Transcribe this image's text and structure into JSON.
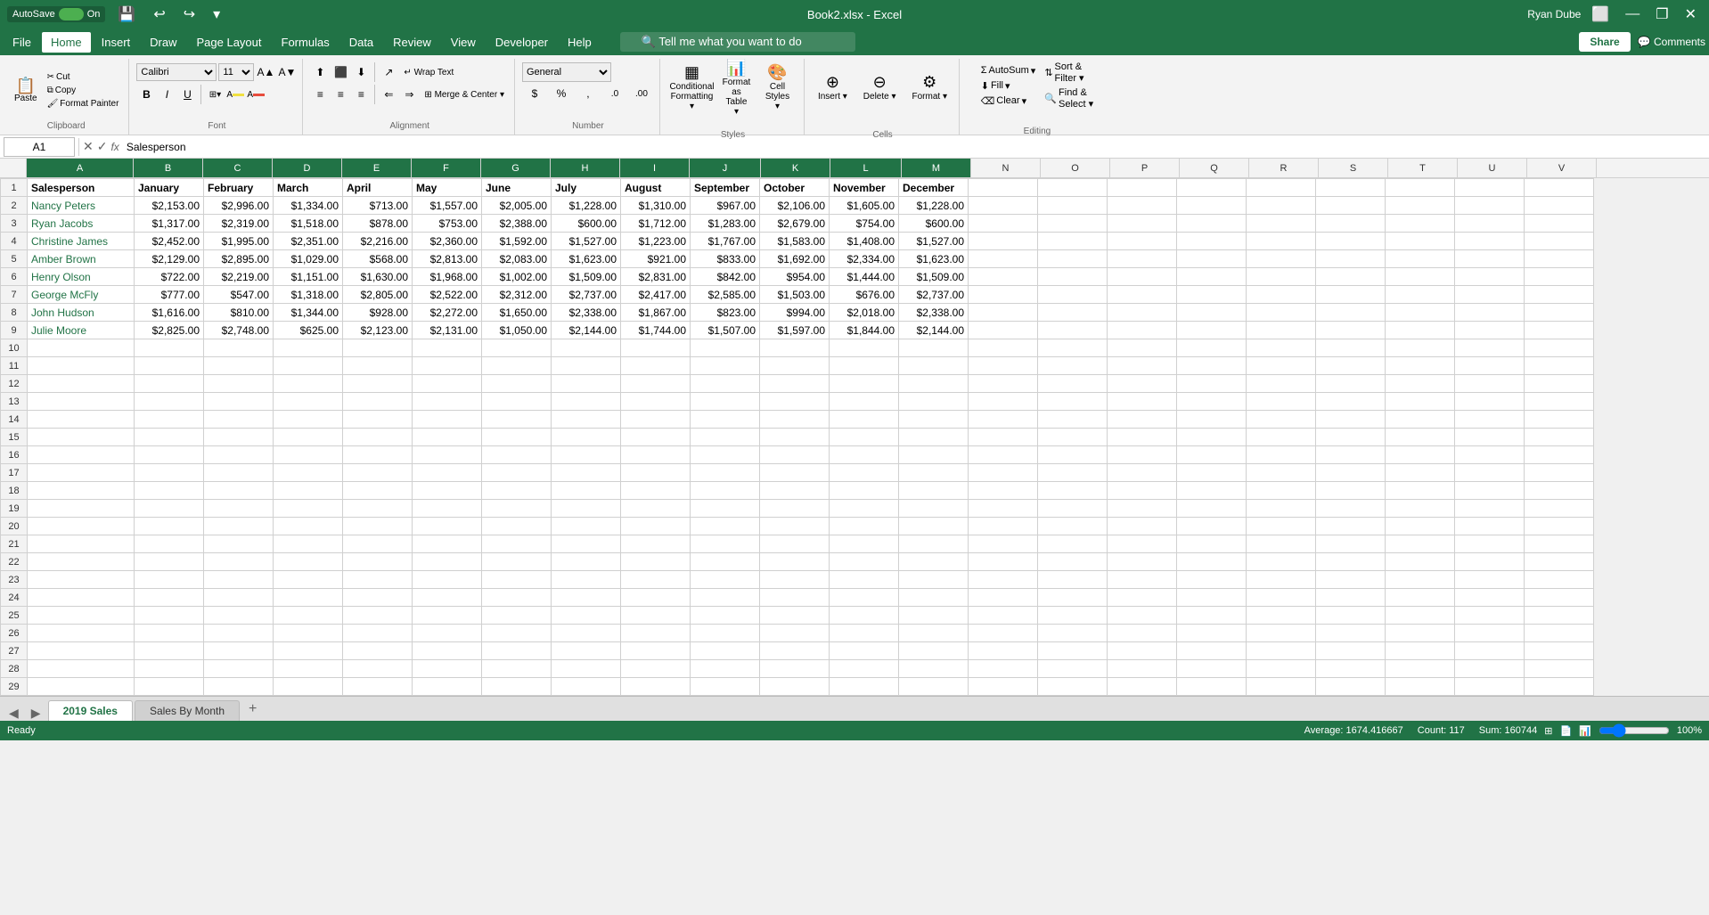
{
  "titleBar": {
    "autosave": "AutoSave",
    "autosaveState": "On",
    "title": "Book2.xlsx - Excel",
    "user": "Ryan Dube"
  },
  "menuBar": {
    "items": [
      "File",
      "Home",
      "Insert",
      "Draw",
      "Page Layout",
      "Formulas",
      "Data",
      "Review",
      "View",
      "Developer",
      "Help"
    ],
    "active": "Home",
    "searchPlaceholder": "Tell me what you want to do",
    "share": "Share",
    "comments": "Comments"
  },
  "ribbon": {
    "clipboard": {
      "label": "Clipboard",
      "paste": "Paste",
      "cut": "Cut",
      "copy": "Copy",
      "formatPainter": "Format Painter"
    },
    "font": {
      "label": "Font",
      "family": "Calibri",
      "size": "11",
      "bold": "B",
      "italic": "I",
      "underline": "U"
    },
    "alignment": {
      "label": "Alignment",
      "wrapText": "Wrap Text",
      "mergeCenter": "Merge & Center"
    },
    "number": {
      "label": "Number",
      "format": "General"
    },
    "styles": {
      "label": "Styles",
      "conditionalFormatting": "Conditional Formatting",
      "formatAsTable": "Format as Table",
      "cellStyles": "Cell Styles"
    },
    "cells": {
      "label": "Cells",
      "insert": "Insert",
      "delete": "Delete",
      "format": "Format"
    },
    "editing": {
      "label": "Editing",
      "autoSum": "AutoSum",
      "fill": "Fill",
      "clear": "Clear",
      "sortFilter": "Sort & Filter",
      "findSelect": "Find & Select"
    }
  },
  "formulaBar": {
    "cellRef": "A1",
    "formula": "Salesperson"
  },
  "columns": [
    "A",
    "B",
    "C",
    "D",
    "E",
    "F",
    "G",
    "H",
    "I",
    "J",
    "K",
    "L",
    "M",
    "N",
    "O",
    "P",
    "Q",
    "R",
    "S",
    "T",
    "U",
    "V"
  ],
  "headers": [
    "Salesperson",
    "January",
    "February",
    "March",
    "April",
    "May",
    "June",
    "July",
    "August",
    "September",
    "October",
    "November",
    "December"
  ],
  "rows": [
    {
      "num": 1,
      "isHeader": true,
      "cells": [
        "Salesperson",
        "January",
        "February",
        "March",
        "April",
        "May",
        "June",
        "July",
        "August",
        "September",
        "October",
        "November",
        "December"
      ]
    },
    {
      "num": 2,
      "cells": [
        "Nancy Peters",
        "$2,153.00",
        "$2,996.00",
        "$1,334.00",
        "$713.00",
        "$1,557.00",
        "$2,005.00",
        "$1,228.00",
        "$1,310.00",
        "$967.00",
        "$2,106.00",
        "$1,605.00",
        "$1,228.00"
      ]
    },
    {
      "num": 3,
      "cells": [
        "Ryan Jacobs",
        "$1,317.00",
        "$2,319.00",
        "$1,518.00",
        "$878.00",
        "$753.00",
        "$2,388.00",
        "$600.00",
        "$1,712.00",
        "$1,283.00",
        "$2,679.00",
        "$754.00",
        "$600.00"
      ]
    },
    {
      "num": 4,
      "cells": [
        "Christine James",
        "$2,452.00",
        "$1,995.00",
        "$2,351.00",
        "$2,216.00",
        "$2,360.00",
        "$1,592.00",
        "$1,527.00",
        "$1,223.00",
        "$1,767.00",
        "$1,583.00",
        "$1,408.00",
        "$1,527.00"
      ]
    },
    {
      "num": 5,
      "cells": [
        "Amber Brown",
        "$2,129.00",
        "$2,895.00",
        "$1,029.00",
        "$568.00",
        "$2,813.00",
        "$2,083.00",
        "$1,623.00",
        "$921.00",
        "$833.00",
        "$1,692.00",
        "$2,334.00",
        "$1,623.00"
      ]
    },
    {
      "num": 6,
      "cells": [
        "Henry Olson",
        "$722.00",
        "$2,219.00",
        "$1,151.00",
        "$1,630.00",
        "$1,968.00",
        "$1,002.00",
        "$1,509.00",
        "$2,831.00",
        "$842.00",
        "$954.00",
        "$1,444.00",
        "$1,509.00"
      ]
    },
    {
      "num": 7,
      "cells": [
        "George McFly",
        "$777.00",
        "$547.00",
        "$1,318.00",
        "$2,805.00",
        "$2,522.00",
        "$2,312.00",
        "$2,737.00",
        "$2,417.00",
        "$2,585.00",
        "$1,503.00",
        "$676.00",
        "$2,737.00"
      ]
    },
    {
      "num": 8,
      "cells": [
        "John Hudson",
        "$1,616.00",
        "$810.00",
        "$1,344.00",
        "$928.00",
        "$2,272.00",
        "$1,650.00",
        "$2,338.00",
        "$1,867.00",
        "$823.00",
        "$994.00",
        "$2,018.00",
        "$2,338.00"
      ]
    },
    {
      "num": 9,
      "cells": [
        "Julie Moore",
        "$2,825.00",
        "$2,748.00",
        "$625.00",
        "$2,123.00",
        "$2,131.00",
        "$1,050.00",
        "$2,144.00",
        "$1,744.00",
        "$1,507.00",
        "$1,597.00",
        "$1,844.00",
        "$2,144.00"
      ]
    }
  ],
  "emptyRows": [
    10,
    11,
    12,
    13,
    14,
    15,
    16,
    17,
    18,
    19,
    20,
    21,
    22,
    23,
    24,
    25,
    26,
    27,
    28,
    29
  ],
  "tabs": [
    {
      "label": "2019 Sales",
      "active": true
    },
    {
      "label": "Sales By Month",
      "active": false
    }
  ],
  "statusBar": {
    "average": "Average: 1674.416667",
    "count": "Count: 117",
    "sum": "Sum: 160744"
  }
}
